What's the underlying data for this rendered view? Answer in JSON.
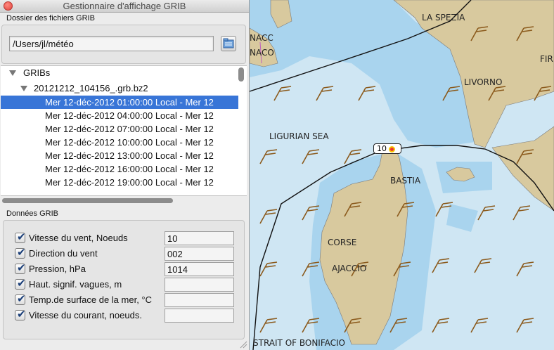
{
  "window": {
    "title": "Gestionnaire d'affichage GRIB"
  },
  "folder_section": {
    "label": "Dossier des fichiers GRIB",
    "path_value": "/Users/jl/météo"
  },
  "tree": {
    "root_label": "GRIBs",
    "file_label": "20121212_104156_.grb.bz2",
    "records": [
      "Mer 12-déc-2012 01:00:00 Local - Mer 12",
      "Mer 12-déc-2012 04:00:00 Local - Mer 12",
      "Mer 12-déc-2012 07:00:00 Local - Mer 12",
      "Mer 12-déc-2012 10:00:00 Local - Mer 12",
      "Mer 12-déc-2012 13:00:00 Local - Mer 12",
      "Mer 12-déc-2012 16:00:00 Local - Mer 12",
      "Mer 12-déc-2012 19:00:00 Local - Mer 12"
    ],
    "selected_index": 0
  },
  "data_section": {
    "label": "Données GRIB",
    "fields": [
      {
        "label": "Vitesse du vent, Noeuds",
        "value": "10",
        "checked": true
      },
      {
        "label": "Direction du vent",
        "value": "002",
        "checked": true
      },
      {
        "label": "Pression, hPa",
        "value": "1014",
        "checked": true
      },
      {
        "label": "Haut. signif. vagues, m",
        "value": "",
        "checked": true
      },
      {
        "label": "Temp.de surface de la mer, °C",
        "value": "",
        "checked": true
      },
      {
        "label": "Vitesse du courant, noeuds.",
        "value": "",
        "checked": true
      }
    ]
  },
  "map": {
    "labels": {
      "la_spezia": "LA SPEZIA",
      "livorno": "LIVORNO",
      "firenze": "FIR",
      "monaco_1": "NACC",
      "monaco_2": "NACO",
      "ligurian_sea": "LIGURIAN SEA",
      "bastia": "BASTIA",
      "corse": "CORSE",
      "ajaccio": "AJACCIO",
      "bonifacio": "STRAIT OF BONIFACIO"
    },
    "position_marker": "10",
    "colors": {
      "sea": "#cfe6f3",
      "shallow": "#a9d4ee",
      "land": "#d8c99e",
      "wind_barb": "#8b5a1c",
      "selection": "#3875d7"
    }
  }
}
